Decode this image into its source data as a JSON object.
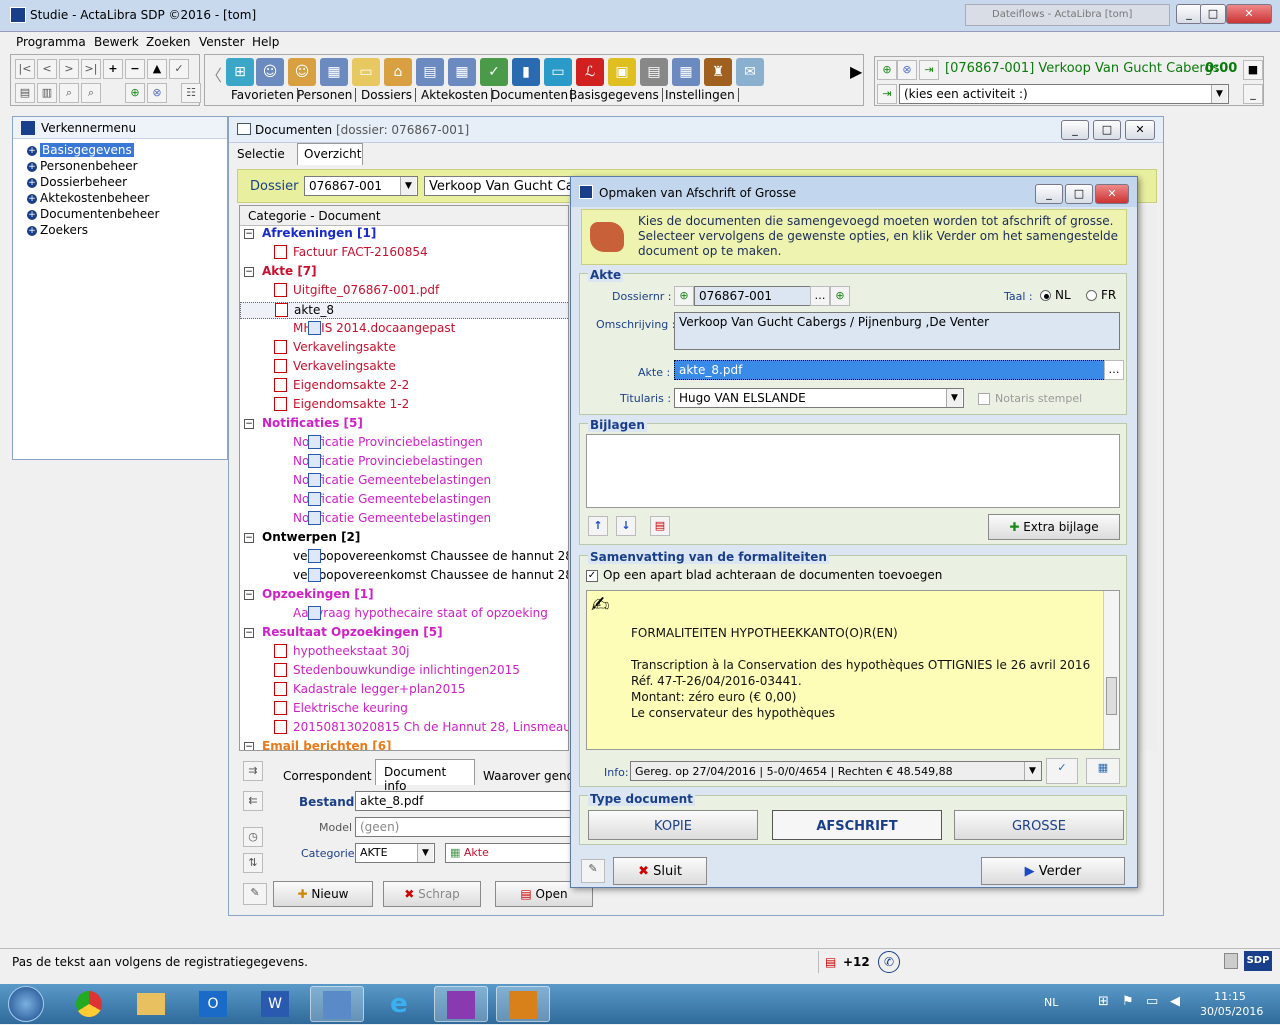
{
  "window": {
    "title": "Studie - ActaLibra  SDP ©2016 - [tom]",
    "bg_window": "Dateiflows - ActaLibra [tom]"
  },
  "menu": [
    "Programma",
    "Bewerk",
    "Zoeken",
    "Venster",
    "Help"
  ],
  "toolbar_tabs": [
    "Favorieten",
    "Personen",
    "Dossiers",
    "Aktekosten",
    "Documenten",
    "Basisgegevens",
    "Instellingen"
  ],
  "activity": {
    "dossier": "[076867-001] Verkoop Van Gucht  Cabergs",
    "timer": "0:00",
    "placeholder": "(kies een activiteit :)"
  },
  "explorer": {
    "title": "Verkennermenu",
    "items": [
      "Basisgegevens",
      "Personenbeheer",
      "Dossierbeheer",
      "Aktekostenbeheer",
      "Documentenbeheer",
      "Zoekers"
    ]
  },
  "documents": {
    "title": "Documenten",
    "subtitle": "[dossier: 076867-001]",
    "tabs": [
      "Selectie",
      "Overzicht"
    ],
    "dossier_label": "Dossier",
    "dossier_value": "076867-001",
    "dossier_desc": "Verkoop Van Gucht  Cab",
    "list_header": "Categorie - Document",
    "categories": [
      {
        "name": "Afrekeningen [1]",
        "color": "#1a2bc8",
        "docs": [
          {
            "name": "Factuur FACT-2160854",
            "type": "pdf",
            "color": "#c8102e"
          }
        ]
      },
      {
        "name": "Akte [7]",
        "color": "#c8102e",
        "docs": [
          {
            "name": "Uitgifte_076867-001.pdf",
            "type": "pdf",
            "color": "#c8102e"
          },
          {
            "name": "akte_8",
            "type": "pdf",
            "color": "#000000"
          },
          {
            "name": "MHUIS 2014.docaangepast",
            "type": "doc",
            "color": "#c8102e"
          },
          {
            "name": "Verkavelingsakte",
            "type": "pdf",
            "color": "#c8102e"
          },
          {
            "name": "Verkavelingsakte",
            "type": "pdf",
            "color": "#c8102e"
          },
          {
            "name": "Eigendomsakte 2-2",
            "type": "pdf",
            "color": "#c8102e"
          },
          {
            "name": "Eigendomsakte 1-2",
            "type": "pdf",
            "color": "#c8102e"
          }
        ]
      },
      {
        "name": "Notificaties [5]",
        "color": "#d020c8",
        "docs": [
          {
            "name": "Notificatie Provinciebelastingen",
            "type": "doc",
            "color": "#d020c8"
          },
          {
            "name": "Notificatie Provinciebelastingen",
            "type": "doc",
            "color": "#d020c8"
          },
          {
            "name": "Notificatie Gemeentebelastingen",
            "type": "doc",
            "color": "#d020c8"
          },
          {
            "name": "Notificatie Gemeentebelastingen",
            "type": "doc",
            "color": "#d020c8"
          },
          {
            "name": "Notificatie Gemeentebelastingen",
            "type": "doc",
            "color": "#d020c8"
          }
        ]
      },
      {
        "name": "Ontwerpen [2]",
        "color": "#000000",
        "docs": [
          {
            "name": "verkoopovereenkomst Chaussee de hannut 28",
            "type": "doc",
            "color": "#000000"
          },
          {
            "name": "verkoopovereenkomst Chaussee de hannut 28",
            "type": "doc",
            "color": "#000000"
          }
        ]
      },
      {
        "name": "Opzoekingen [1]",
        "color": "#d020c8",
        "docs": [
          {
            "name": "Aanvraag hypothecaire staat of opzoeking",
            "type": "doc",
            "color": "#d020c8"
          }
        ]
      },
      {
        "name": "Resultaat Opzoekingen [5]",
        "color": "#d020c8",
        "docs": [
          {
            "name": "hypotheekstaat 30j",
            "type": "pdf",
            "color": "#d020c8"
          },
          {
            "name": "Stedenbouwkundige inlichtingen2015",
            "type": "pdf",
            "color": "#d020c8"
          },
          {
            "name": "Kadastrale legger+plan2015",
            "type": "pdf",
            "color": "#d020c8"
          },
          {
            "name": "Elektrische keuring",
            "type": "pdf",
            "color": "#d020c8"
          },
          {
            "name": "20150813020815 Ch de Hannut 28, Linsmeau",
            "type": "pdf",
            "color": "#d020c8"
          }
        ]
      },
      {
        "name": "Email berichten [6]",
        "color": "#e87a1a",
        "docs": []
      }
    ],
    "detail_tabs": [
      "Correspondent",
      "Document info",
      "Waarover geno"
    ],
    "bestand_label": "Bestand",
    "bestand_value": "akte_8.pdf",
    "model_label": "Model",
    "model_value": "(geen)",
    "categorie_label": "Categorie",
    "categorie_value": "AKTE",
    "categorie_tag": "Akte",
    "buttons": {
      "new": "Nieuw",
      "delete": "Schrap",
      "open": "Open"
    }
  },
  "dialog": {
    "title": "Opmaken van Afschrift of Grosse",
    "info": "Kies de documenten die samengevoegd moeten worden tot afschrift of grosse.\nSelecteer vervolgens de gewenste opties, en klik Verder om het samengestelde\ndocument op te maken.",
    "akte_section": "Akte",
    "dossiernr_label": "Dossiernr :",
    "dossiernr_value": "076867-001",
    "taal_label": "Taal :",
    "taal_nl": "NL",
    "taal_fr": "FR",
    "omschrijving_label": "Omschrijving :",
    "omschrijving_value": "Verkoop Van Gucht  Cabergs / Pijnenburg ,De Venter",
    "akte_label": "Akte :",
    "akte_value": "akte_8.pdf",
    "titularis_label": "Titularis :",
    "titularis_value": "Hugo VAN ELSLANDE",
    "notaris_stempel": "Notaris stempel",
    "bijlagen_section": "Bijlagen",
    "extra_bijlage": "Extra bijlage",
    "samenvatting_section": "Samenvatting van de formaliteiten",
    "apart_blad": "Op een apart blad achteraan de documenten toevoegen",
    "summary_lines": [
      "FORMALITEITEN HYPOTHEEKKANTO(O)R(EN)",
      "",
      "Transcription à la Conservation des hypothèques OTTIGNIES le 26 avril 2016",
      "Réf. 47-T-26/04/2016-03441.",
      "Montant: zéro euro (€ 0,00)",
      "Le conservateur des hypothèques"
    ],
    "info_label": "Info:",
    "info_value": "Gereg. op 27/04/2016 | 5-0/0/4654 | Rechten € 48.549,88",
    "type_section": "Type document",
    "type_buttons": [
      "KOPIE",
      "AFSCHRIFT",
      "GROSSE"
    ],
    "sluit": "Sluit",
    "verder": "Verder"
  },
  "statusbar": {
    "text": "Pas de tekst aan volgens de registratiegegevens.",
    "count": "+12"
  },
  "taskbar": {
    "lang": "NL",
    "time": "11:15",
    "date": "30/05/2016"
  }
}
